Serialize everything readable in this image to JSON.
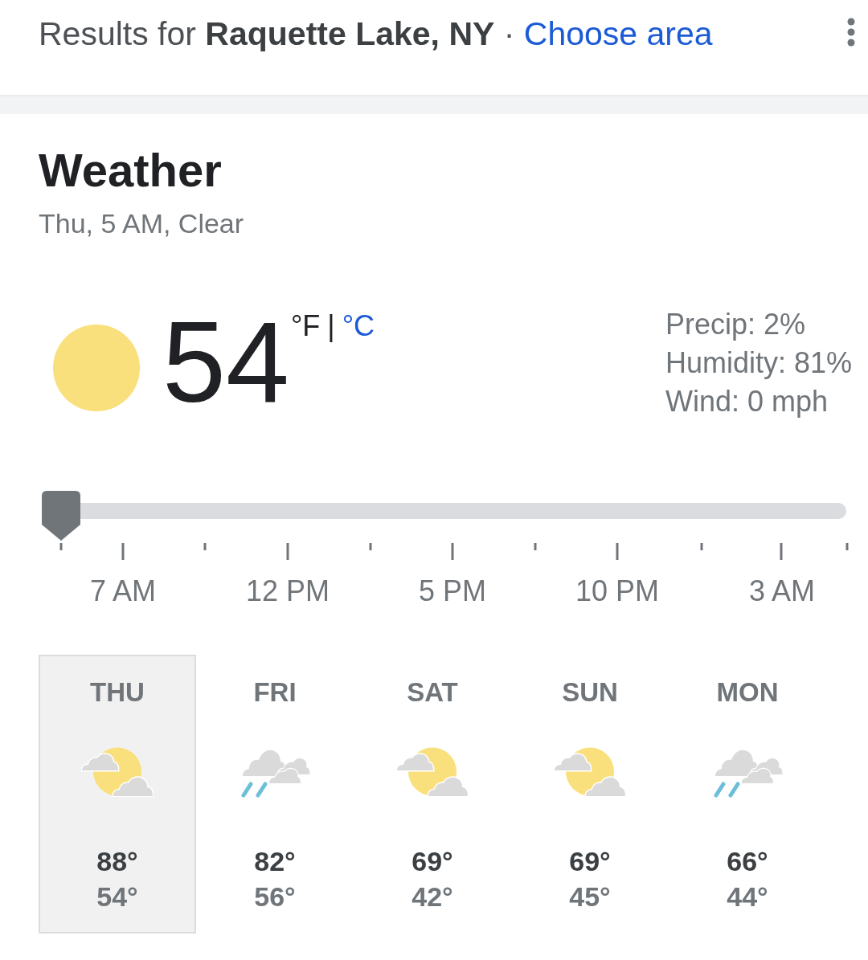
{
  "header": {
    "results": "Results for **Raquette Lake, NY**",
    "separator": "·",
    "link": "Choose area"
  },
  "weather": {
    "title": "Weather",
    "subtitle": "Thu, 5 AM, Clear",
    "kind": "sunny",
    "temperature": "54",
    "units": [
      {
        "label": "°F",
        "selected": true
      },
      {
        "label": "°C",
        "selected": false
      }
    ],
    "unit_divider": "|",
    "details": [
      "Precip: 2%",
      "Humidity: 81%",
      "Wind: 0 mph"
    ]
  },
  "timeline": {
    "level": 0,
    "labels": [
      "7 AM",
      "12 PM",
      "5 PM",
      "10 PM",
      "3 AM"
    ]
  },
  "forecast": [
    {
      "day": "THU",
      "kind": "partlycloudy",
      "high": "88°",
      "low": "54°",
      "selected": true
    },
    {
      "day": "FRI",
      "kind": "showers",
      "high": "82°",
      "low": "56°",
      "selected": false
    },
    {
      "day": "SAT",
      "kind": "partlycloudy",
      "high": "69°",
      "low": "42°",
      "selected": false
    },
    {
      "day": "SUN",
      "kind": "partlycloudy",
      "high": "69°",
      "low": "45°",
      "selected": false
    },
    {
      "day": "MON",
      "kind": "showers",
      "high": "66°",
      "low": "44°",
      "selected": false
    }
  ]
}
